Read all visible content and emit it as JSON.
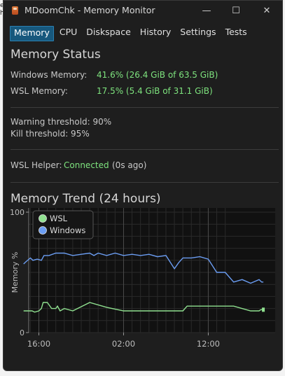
{
  "edge": {
    "line1": "e",
    "line2": "he"
  },
  "window": {
    "title": "MDoomChk - Memory Monitor",
    "controls": {
      "minimize": "—",
      "maximize": "☐",
      "close": "✕"
    }
  },
  "tabs": [
    {
      "label": "Memory",
      "active": true
    },
    {
      "label": "CPU"
    },
    {
      "label": "Diskspace"
    },
    {
      "label": "History"
    },
    {
      "label": "Settings"
    },
    {
      "label": "Tests"
    }
  ],
  "status": {
    "heading": "Memory Status",
    "windows_label": "Windows Memory:",
    "windows_value": "41.6% (26.4 GiB of 63.5 GiB)",
    "wsl_label": "WSL Memory:",
    "wsl_value": "17.5% (5.4 GiB of 31.1 GiB)",
    "warning_threshold": "Warning threshold: 90%",
    "kill_threshold": "Kill threshold: 95%",
    "helper_label": "WSL Helper:",
    "helper_status": "Connected",
    "helper_age": "(0s ago)"
  },
  "trend": {
    "heading": "Memory Trend (24 hours)"
  },
  "colors": {
    "accent": "#17587d",
    "green": "#7ee37e",
    "blue": "#6d9ef0",
    "wsl_line": "#8fe08f",
    "windows_line": "#6b9df2"
  },
  "chart_data": {
    "type": "line",
    "ylabel": "Memory %",
    "ylim": [
      0,
      100
    ],
    "yticks": [
      "0",
      "100"
    ],
    "xticks": [
      "16:00",
      "02:00",
      "12:00"
    ],
    "legend": {
      "placement": "top-left",
      "entries": [
        "WSL",
        "Windows"
      ]
    },
    "grid": true,
    "x_hours": [
      -1,
      0,
      1,
      2,
      3,
      4,
      5,
      6,
      7,
      8,
      9,
      10,
      11,
      12,
      13,
      14,
      15,
      16,
      17,
      18,
      19,
      20,
      21,
      22
    ],
    "series": [
      {
        "name": "WSL",
        "color": "#8fe08f",
        "x": [
          -0.8,
          -0.5,
          0.2,
          0.5,
          1.0,
          1.3,
          1.5,
          2.0,
          2.5,
          3.0,
          3.2,
          3.5,
          4.0,
          5.0,
          7.0,
          9.0,
          11.0,
          13.0,
          14.0,
          14.2,
          15.0,
          17.0,
          18.0,
          18.5,
          20.0,
          21.0,
          22.0,
          24.0,
          26.0,
          27.0,
          27.2,
          27.5
        ],
        "values": [
          18,
          18,
          18,
          17,
          18,
          20,
          25,
          25,
          20,
          20,
          22,
          18,
          20,
          18,
          25,
          21,
          18,
          18,
          18,
          18,
          18,
          18,
          18,
          22,
          22,
          22,
          22,
          22,
          18,
          18,
          19,
          19
        ]
      },
      {
        "name": "Windows",
        "color": "#6b9df2",
        "x": [
          -0.8,
          -0.5,
          0.0,
          0.3,
          0.8,
          1.3,
          1.6,
          2.2,
          3.0,
          4.0,
          5.0,
          6.0,
          7.0,
          7.5,
          8.0,
          9.0,
          10.0,
          11.0,
          12.0,
          13.0,
          14.0,
          15.0,
          16.0,
          17.0,
          17.5,
          18.0,
          19.0,
          20.0,
          21.0,
          22.0,
          23.0,
          24.0,
          25.0,
          26.0,
          27.0,
          27.3,
          27.5
        ],
        "values": [
          57,
          59,
          62,
          60,
          61,
          60,
          64,
          64,
          66,
          66,
          64,
          65,
          66,
          64,
          66,
          64,
          66,
          64,
          65,
          64,
          65,
          63,
          64,
          53,
          58,
          62,
          62,
          63,
          61,
          50,
          50,
          42,
          44,
          41,
          44,
          42,
          42
        ]
      }
    ]
  }
}
